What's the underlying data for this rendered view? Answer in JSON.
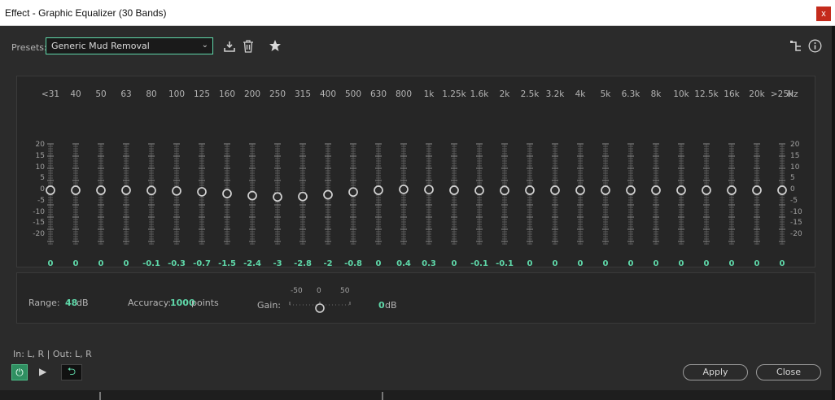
{
  "window": {
    "title": "Effect - Graphic Equalizer (30 Bands)",
    "close_glyph": "x"
  },
  "toolbar": {
    "presets_label": "Presets:",
    "preset_value": "Generic Mud Removal"
  },
  "eq": {
    "unit_label": "Hz",
    "scale_left": [
      "20",
      "15",
      "10",
      "5",
      "0",
      "-5",
      "-10",
      "-15",
      "-20"
    ],
    "scale_right": [
      "20",
      "15",
      "10",
      "5",
      "0",
      "-5",
      "-10",
      "-15",
      "-20"
    ],
    "bands": [
      {
        "label": "<31",
        "value": "0"
      },
      {
        "label": "40",
        "value": "0"
      },
      {
        "label": "50",
        "value": "0"
      },
      {
        "label": "63",
        "value": "0"
      },
      {
        "label": "80",
        "value": "-0.1"
      },
      {
        "label": "100",
        "value": "-0.3"
      },
      {
        "label": "125",
        "value": "-0.7"
      },
      {
        "label": "160",
        "value": "-1.5"
      },
      {
        "label": "200",
        "value": "-2.4"
      },
      {
        "label": "250",
        "value": "-3"
      },
      {
        "label": "315",
        "value": "-2.8"
      },
      {
        "label": "400",
        "value": "-2"
      },
      {
        "label": "500",
        "value": "-0.8"
      },
      {
        "label": "630",
        "value": "0"
      },
      {
        "label": "800",
        "value": "0.4"
      },
      {
        "label": "1k",
        "value": "0.3"
      },
      {
        "label": "1.25k",
        "value": "0"
      },
      {
        "label": "1.6k",
        "value": "-0.1"
      },
      {
        "label": "2k",
        "value": "-0.1"
      },
      {
        "label": "2.5k",
        "value": "0"
      },
      {
        "label": "3.2k",
        "value": "0"
      },
      {
        "label": "4k",
        "value": "0"
      },
      {
        "label": "5k",
        "value": "0"
      },
      {
        "label": "6.3k",
        "value": "0"
      },
      {
        "label": "8k",
        "value": "0"
      },
      {
        "label": "10k",
        "value": "0"
      },
      {
        "label": "12.5k",
        "value": "0"
      },
      {
        "label": "16k",
        "value": "0"
      },
      {
        "label": "20k",
        "value": "0"
      },
      {
        "label": ">25k",
        "value": "0"
      }
    ]
  },
  "controls": {
    "range_label": "Range:",
    "range_value": "48",
    "range_unit": "dB",
    "accuracy_label": "Accuracy:",
    "accuracy_value": "1000",
    "accuracy_unit": "points",
    "gain_label": "Gain:",
    "gain_min": "-50",
    "gain_mid": "0",
    "gain_max": "50",
    "gain_value": "0",
    "gain_unit": "dB"
  },
  "footer": {
    "io_label": "In: L, R | Out: L, R",
    "apply_label": "Apply",
    "close_label": "Close"
  },
  "colors": {
    "accent": "#5fd8a9",
    "panel": "#262626",
    "background": "#2b2b2b"
  }
}
